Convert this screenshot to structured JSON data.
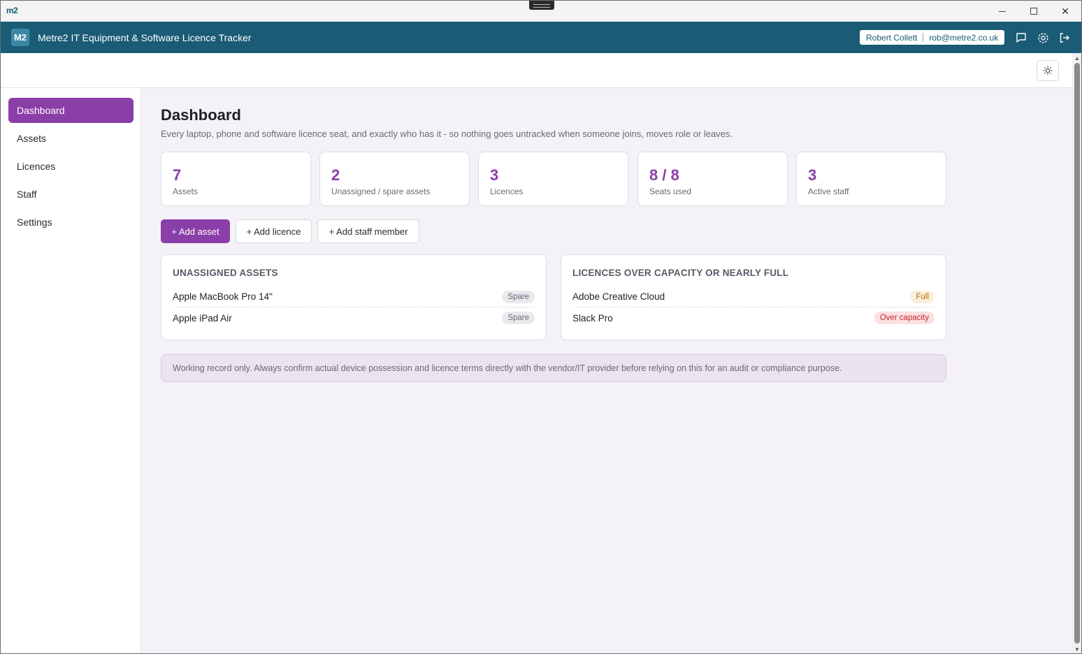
{
  "window": {
    "mini_logo": "m2",
    "minimize_label": "minimize",
    "maximize_label": "maximize",
    "close_label": "✕"
  },
  "header": {
    "badge": "M2",
    "title": "Metre2 IT Equipment & Software Licence Tracker",
    "user_name": "Robert Collett",
    "user_email": "rob@metre2.co.uk",
    "icons": [
      "chat-icon",
      "gear-icon",
      "logout-icon"
    ]
  },
  "sidebar": {
    "items": [
      {
        "label": "Dashboard",
        "active": true
      },
      {
        "label": "Assets"
      },
      {
        "label": "Licences"
      },
      {
        "label": "Staff"
      },
      {
        "label": "Settings"
      }
    ]
  },
  "page": {
    "title": "Dashboard",
    "subtitle": "Every laptop, phone and software licence seat, and exactly who has it - so nothing goes untracked when someone joins, moves role or leaves."
  },
  "stats": [
    {
      "value": "7",
      "label": "Assets"
    },
    {
      "value": "2",
      "label": "Unassigned / spare assets"
    },
    {
      "value": "3",
      "label": "Licences"
    },
    {
      "value": "8 / 8",
      "label": "Seats used"
    },
    {
      "value": "3",
      "label": "Active staff"
    }
  ],
  "actions": {
    "add_asset": "+ Add asset",
    "add_licence": "+ Add licence",
    "add_staff": "+ Add staff member"
  },
  "unassigned": {
    "title": "UNASSIGNED ASSETS",
    "rows": [
      {
        "name": "Apple MacBook Pro 14\"",
        "status": "Spare"
      },
      {
        "name": "Apple iPad Air",
        "status": "Spare"
      }
    ]
  },
  "licences_capacity": {
    "title": "LICENCES OVER CAPACITY OR NEARLY FULL",
    "rows": [
      {
        "name": "Adobe Creative Cloud",
        "status": "Full"
      },
      {
        "name": "Slack Pro",
        "status": "Over capacity"
      }
    ]
  },
  "notice": "Working record only. Always confirm actual device possession and licence terms directly with the vendor/IT provider before relying on this for an audit or compliance purpose.",
  "colors": {
    "header_bg": "#1a5b76",
    "accent": "#8a3ea8",
    "page_bg": "#f4f2f7"
  }
}
